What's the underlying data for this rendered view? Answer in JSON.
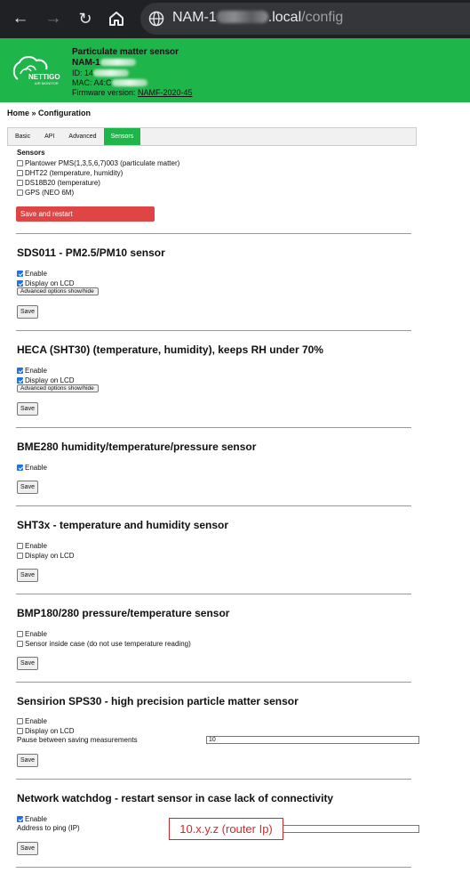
{
  "browser": {
    "url_host_start": "NAM-1",
    "url_host_end": ".local",
    "url_path": "/config"
  },
  "header": {
    "title": "Particulate matter sensor",
    "name_start": "NAM-1",
    "id_label": "ID: 14",
    "mac_label": "MAC: A4:C",
    "firmware_label": "Firmware version:",
    "firmware_value": "NAMF-2020-45",
    "logo_text": "NETTIGO",
    "logo_subtext": "AIR MONITOR",
    "brand_color": "#1eb64b"
  },
  "breadcrumb": "Home » Configuration",
  "tabs": [
    "Basic",
    "API",
    "Advanced",
    "Sensors"
  ],
  "active_tab": "Sensors",
  "sensors_list": {
    "heading": "Sensors",
    "items": [
      {
        "label": "Plantower PMS(1,3,5,6,7)003 (particulate matter)",
        "checked": false
      },
      {
        "label": "DHT22 (temperature, humidity)",
        "checked": false
      },
      {
        "label": "DS18B20 (temperature)",
        "checked": false
      },
      {
        "label": "GPS (NEO 6M)",
        "checked": false
      }
    ],
    "save_restart_label": "Save and restart"
  },
  "sections": {
    "sds011": {
      "title": "SDS011 - PM2.5/PM10 sensor",
      "enable": "Enable",
      "enable_checked": true,
      "display": "Display on LCD",
      "display_checked": true,
      "advanced": "Advanced options show/hide",
      "save": "Save"
    },
    "heca": {
      "title": "HECA (SHT30) (temperature, humidity), keeps RH under 70%",
      "enable": "Enable",
      "enable_checked": true,
      "display": "Display on LCD",
      "display_checked": true,
      "advanced": "Advanced options show/hide",
      "save": "Save"
    },
    "bme280": {
      "title": "BME280 humidity/temperature/pressure sensor",
      "enable": "Enable",
      "enable_checked": true,
      "save": "Save"
    },
    "sht3x": {
      "title": "SHT3x - temperature and humidity sensor",
      "enable": "Enable",
      "enable_checked": false,
      "display": "Display on LCD",
      "display_checked": false,
      "save": "Save"
    },
    "bmp180": {
      "title": "BMP180/280 pressure/temperature sensor",
      "enable": "Enable",
      "enable_checked": false,
      "inside": "Sensor inside case (do not use temperature reading)",
      "inside_checked": false,
      "save": "Save"
    },
    "sps30": {
      "title": "Sensirion SPS30 - high precision particle matter sensor",
      "enable": "Enable",
      "enable_checked": false,
      "display": "Display on LCD",
      "display_checked": false,
      "pause_label": "Pause between saving measurements",
      "pause_value": "10",
      "save": "Save"
    },
    "watchdog": {
      "title": "Network watchdog - restart sensor in case lack of connectivity",
      "enable": "Enable",
      "enable_checked": true,
      "ping_label": "Address to ping (IP)",
      "ping_value": "",
      "save": "Save"
    }
  },
  "annotation": "10.x.y.z (router Ip)"
}
